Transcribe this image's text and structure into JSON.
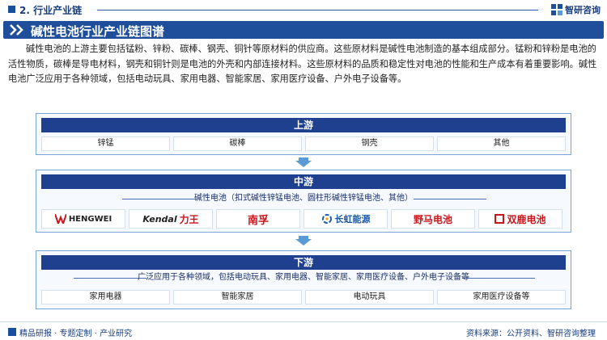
{
  "header": {
    "section_title": "2. 行业产业链",
    "brand_name": "智研咨询",
    "page_title": "碱性电池行业产业链图谱"
  },
  "intro": "碱性电池的上游主要包括锰粉、锌粉、碳棒、钢壳、铜针等原材料的供应商。这些原材料是碱性电池制造的基本组成部分。锰粉和锌粉是电池的活性物质，碳棒是导电材料，钢壳和铜针则是电池的外壳和内部连接材料。这些原材料的品质和稳定性对电池的性能和生产成本有着重要影响。碱性电池广泛应用于各种领域，包括电动玩具、家用电器、智能家居、家用医疗设备、户外电子设备等。",
  "upstream": {
    "title": "上游",
    "items": [
      "锌锰",
      "碳棒",
      "钢壳",
      "其他"
    ]
  },
  "midstream": {
    "title": "中游",
    "description": "碱性电池（扣式碱性锌锰电池、圆柱形碱性锌锰电池、其他）",
    "companies": [
      {
        "name": "HENGWEI",
        "sub": "恒威电池股份有限公司",
        "color": "#c8161d"
      },
      {
        "name": "Kendal",
        "accent": "力王",
        "color": "#c8161d"
      },
      {
        "name": "南孚",
        "color": "#c8161d"
      },
      {
        "name": "长虹能源",
        "sub": "CHANGHONG ENERGY",
        "color": "#1b5aa6"
      },
      {
        "name": "野马电池",
        "sub": "Mustang",
        "color": "#c8161d"
      },
      {
        "name": "双鹿电池",
        "color": "#c8161d"
      }
    ]
  },
  "downstream": {
    "title": "下游",
    "description": "广泛应用于各种领域，包括电动玩具、家用电器、智能家居、家用医疗设备、户外电子设备等",
    "items": [
      "家用电器",
      "智能家居",
      "电动玩具",
      "家用医疗设备等"
    ]
  },
  "footer": {
    "left": "精品研报 · 专题定制 · 产业研究",
    "right": "资料来源：公开资料、智研咨询整理"
  },
  "colors": {
    "primary": "#1f4f9b",
    "panel_head": "#1f3f8f",
    "panel_border": "#7aa3d6",
    "arrow": "#5b9bd5",
    "logo_red": "#c8161d"
  },
  "icons": {
    "title_chevron": "double-chevron-right-icon",
    "flow_arrow": "down-arrow-icon",
    "brand_logo": "zhiyan-logo-icon"
  }
}
